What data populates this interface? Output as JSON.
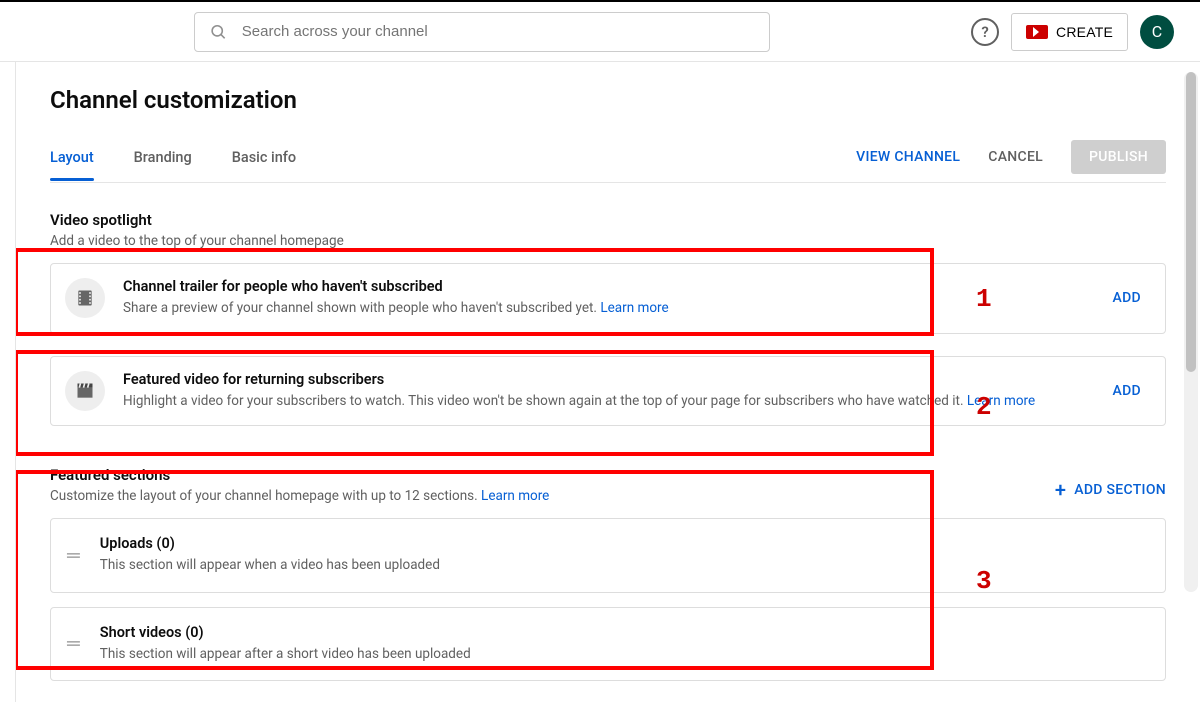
{
  "search": {
    "placeholder": "Search across your channel"
  },
  "create_label": "CREATE",
  "avatar_letter": "C",
  "page_title": "Channel customization",
  "tabs": [
    {
      "label": "Layout",
      "active": true
    },
    {
      "label": "Branding",
      "active": false
    },
    {
      "label": "Basic info",
      "active": false
    }
  ],
  "actions": {
    "view_channel": "VIEW CHANNEL",
    "cancel": "CANCEL",
    "publish": "PUBLISH"
  },
  "spotlight": {
    "title": "Video spotlight",
    "subtitle": "Add a video to the top of your channel homepage",
    "cards": [
      {
        "title": "Channel trailer for people who haven't subscribed",
        "desc": "Share a preview of your channel shown with people who haven't subscribed yet.  ",
        "learn": "Learn more",
        "action": "ADD"
      },
      {
        "title": "Featured video for returning subscribers",
        "desc": "Highlight a video for your subscribers to watch. This video won't be shown again at the top of your page for subscribers who have watched it.  ",
        "learn": "Learn more",
        "action": "ADD"
      }
    ]
  },
  "featured": {
    "title": "Featured sections",
    "subtitle": "Customize the layout of your channel homepage with up to 12 sections. ",
    "learn": "Learn more",
    "add_section": "ADD SECTION",
    "rows": [
      {
        "title": "Uploads (0)",
        "desc": "This section will appear when a video has been uploaded"
      },
      {
        "title": "Short videos (0)",
        "desc": "This section will appear after a short video has been uploaded"
      }
    ]
  },
  "annotations": [
    "1",
    "2",
    "3"
  ]
}
